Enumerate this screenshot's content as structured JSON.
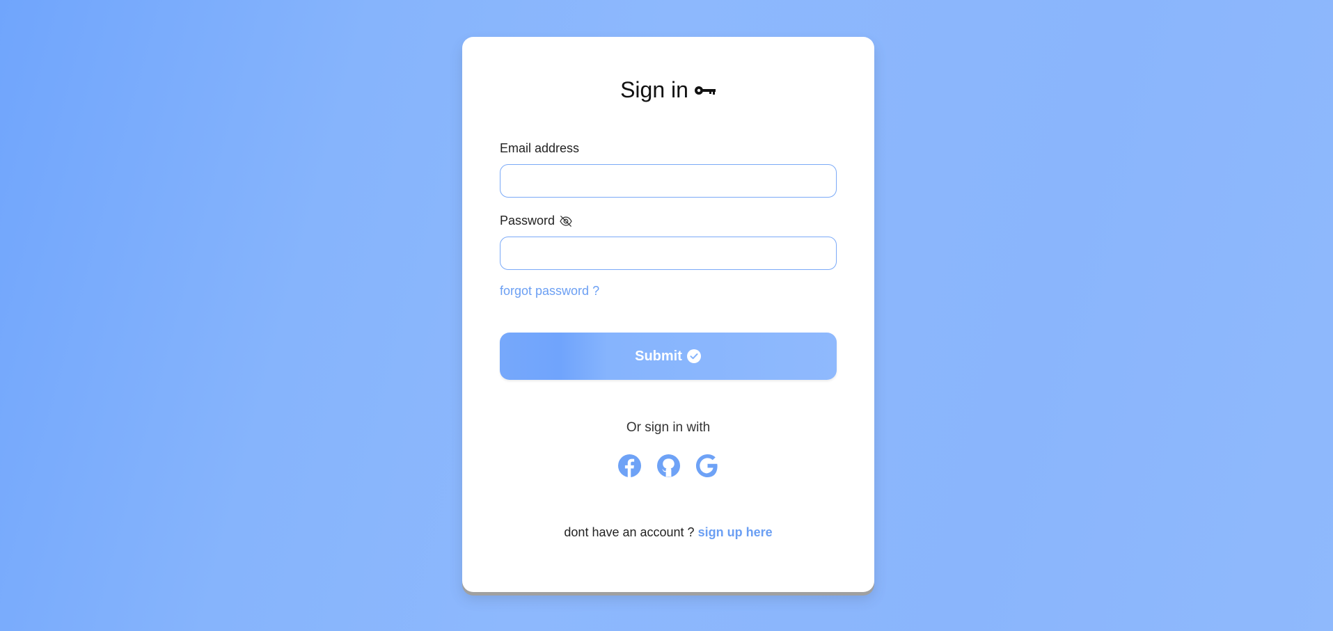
{
  "colors": {
    "accent": "#6b9ff3",
    "input_border": "#7aa9f7",
    "background_start": "#70a5fc",
    "background_end": "#8fb9fc",
    "card": "#ffffff"
  },
  "header": {
    "title": "Sign in",
    "title_icon": "key-icon"
  },
  "form": {
    "email_label": "Email address",
    "email_value": "",
    "password_label": "Password",
    "password_icon": "eye-off-icon",
    "password_value": "",
    "forgot_label": "forgot password ?",
    "submit_label": "Submit",
    "submit_icon": "check-circle-icon"
  },
  "social": {
    "label": "Or sign in with",
    "providers": [
      {
        "name": "facebook",
        "icon": "facebook-icon"
      },
      {
        "name": "github",
        "icon": "github-icon"
      },
      {
        "name": "google",
        "icon": "google-icon"
      }
    ]
  },
  "footer": {
    "prompt": "dont have an account ?",
    "signup_label": "sign up here"
  }
}
